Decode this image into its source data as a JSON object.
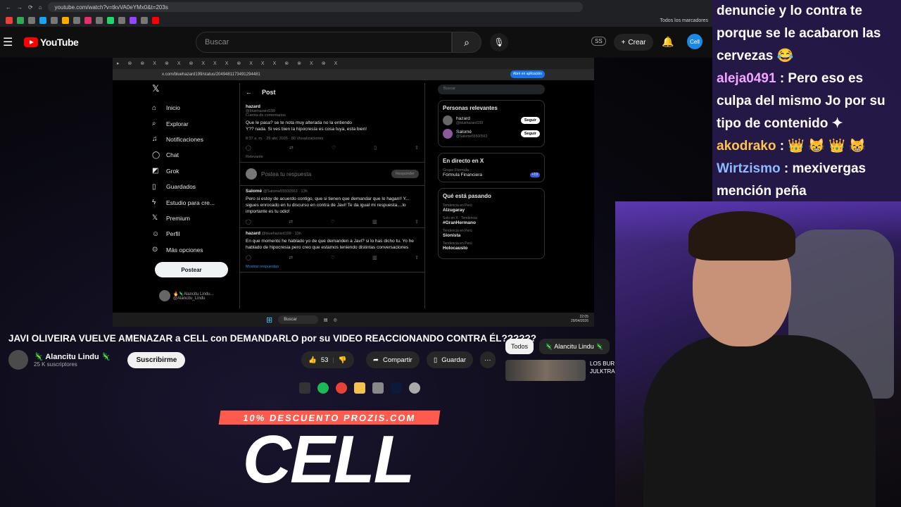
{
  "browser": {
    "url": "youtube.com/watch?v=tkvVA0eYMx0&t=203s",
    "bookmarks_all": "Todos los marcadores"
  },
  "youtube": {
    "logo": "YouTube",
    "search_placeholder": "Buscar",
    "ss_badge": "SS",
    "create_label": "Crear",
    "avatar_label": "Cell"
  },
  "inner_browser": {
    "url": "x.com/bluehazard199/status/2049481173491294481",
    "app_button": "Abrir en aplicación"
  },
  "x_sidebar": {
    "items": [
      {
        "icon": "home-icon",
        "label": "Inicio"
      },
      {
        "icon": "search-icon",
        "label": "Explorar"
      },
      {
        "icon": "bell-icon",
        "label": "Notificaciones"
      },
      {
        "icon": "chat-icon",
        "label": "Chat"
      },
      {
        "icon": "grok-icon",
        "label": "Grok"
      },
      {
        "icon": "bookmark-icon",
        "label": "Guardados"
      },
      {
        "icon": "lightning-icon",
        "label": "Estudio para cre..."
      },
      {
        "icon": "x-logo-icon",
        "label": "Premium"
      },
      {
        "icon": "person-icon",
        "label": "Perfil"
      },
      {
        "icon": "more-icon",
        "label": "Más opciones"
      }
    ],
    "post_button": "Postear",
    "user_name": "🔥🦎Alancitu Lindu...",
    "user_handle": "@Alancitu_Lindu"
  },
  "x_main": {
    "header": "Post",
    "main_tweet": {
      "name": "hazard",
      "handle": "@bluehazard199",
      "community_note": "Cuenta de comentarios",
      "text": "Que le pasa? se te nota muy alterada no la entiendo\nY?? nada. Si ves bien la hipocresía es cosa tuya, esta bien!",
      "meta": "8:37 a. m. · 29 abr. 2026 · 80 Visualizaciones",
      "sort": "Relevante"
    },
    "reply_placeholder": "Postea tu respuesta",
    "reply_button": "Responder",
    "replies": [
      {
        "name": "Salomé",
        "handle": "@Salome55500563 · 13h",
        "text": "Pero si estoy de acuerdo contigo, que si tienen que demandar que lo hagan!! Y... sigues enrocado en tu discurso en contra de Javi! Te da igual mi respuesta....lo importante es tu odio!"
      },
      {
        "name": "hazard",
        "handle": "@bluehazard199 · 13h",
        "text": "En que momento he hablado yo de que demanden a Javi? si lo has dicho tu. Yo he hablado de hipocresia pero creo que estamos teniendo distintas conversaciones"
      }
    ],
    "show_replies": "Mostrar respuestas"
  },
  "x_right": {
    "search_placeholder": "Buscar",
    "people_title": "Personas relevantes",
    "people": [
      {
        "name": "hazard",
        "handle": "@bluehazard199",
        "follow": "Seguir"
      },
      {
        "name": "Salomé",
        "handle": "@Salome55500563",
        "follow": "Seguir"
      }
    ],
    "live_title": "En directo en X",
    "live_host": "Grupo Fórmula",
    "live_show": "Fórmula Financiera",
    "live_count": "+19",
    "trends_title": "Qué está pasando",
    "trends": [
      {
        "category": "Tendencia en Perú",
        "topic": "Alzugaray"
      },
      {
        "category": "Solo en X · Tendencia",
        "topic": "#GranHermano"
      },
      {
        "category": "Tendencia en Perú",
        "topic": "Sionista"
      },
      {
        "category": "Tendencia en Perú",
        "topic": "Holocausto"
      }
    ]
  },
  "taskbar": {
    "search": "Buscar",
    "time": "22:05",
    "date": "29/04/2026",
    "lang": "ESP LAA"
  },
  "video": {
    "title": "JAVI OLIVEIRA VUELVE AMENAZAR a CELL con DEMANDARLO por su VIDEO REACCIONANDO CONTRA ÉL??????",
    "channel": "🦎 Alancitu Lindu 🦎",
    "subscribers": "25 K suscriptores",
    "subscribe": "Suscribirme",
    "likes": "53",
    "share": "Compartir",
    "save": "Guardar",
    "more": "···"
  },
  "chips": {
    "all": "Todos",
    "channel": "🦎 Alancitu Lindu 🦎"
  },
  "recommendation": {
    "title": "LOS BUR JULKTRA"
  },
  "promo": {
    "tag": "10% DESCUENTO PROZIS.COM",
    "name": "CELL"
  },
  "chat": [
    {
      "user": "",
      "text": "denuncie y lo contra te porque se le acabaron las cervezas 😂"
    },
    {
      "user": "aleja0491",
      "text": ": Pero eso es culpa del mismo Jo por su tipo de contenido ✦"
    },
    {
      "user": "akodrako",
      "text": ": 👑 😸 👑 😸"
    },
    {
      "user": "Wirtzismo",
      "text": ": mexivergas mención peña"
    }
  ]
}
